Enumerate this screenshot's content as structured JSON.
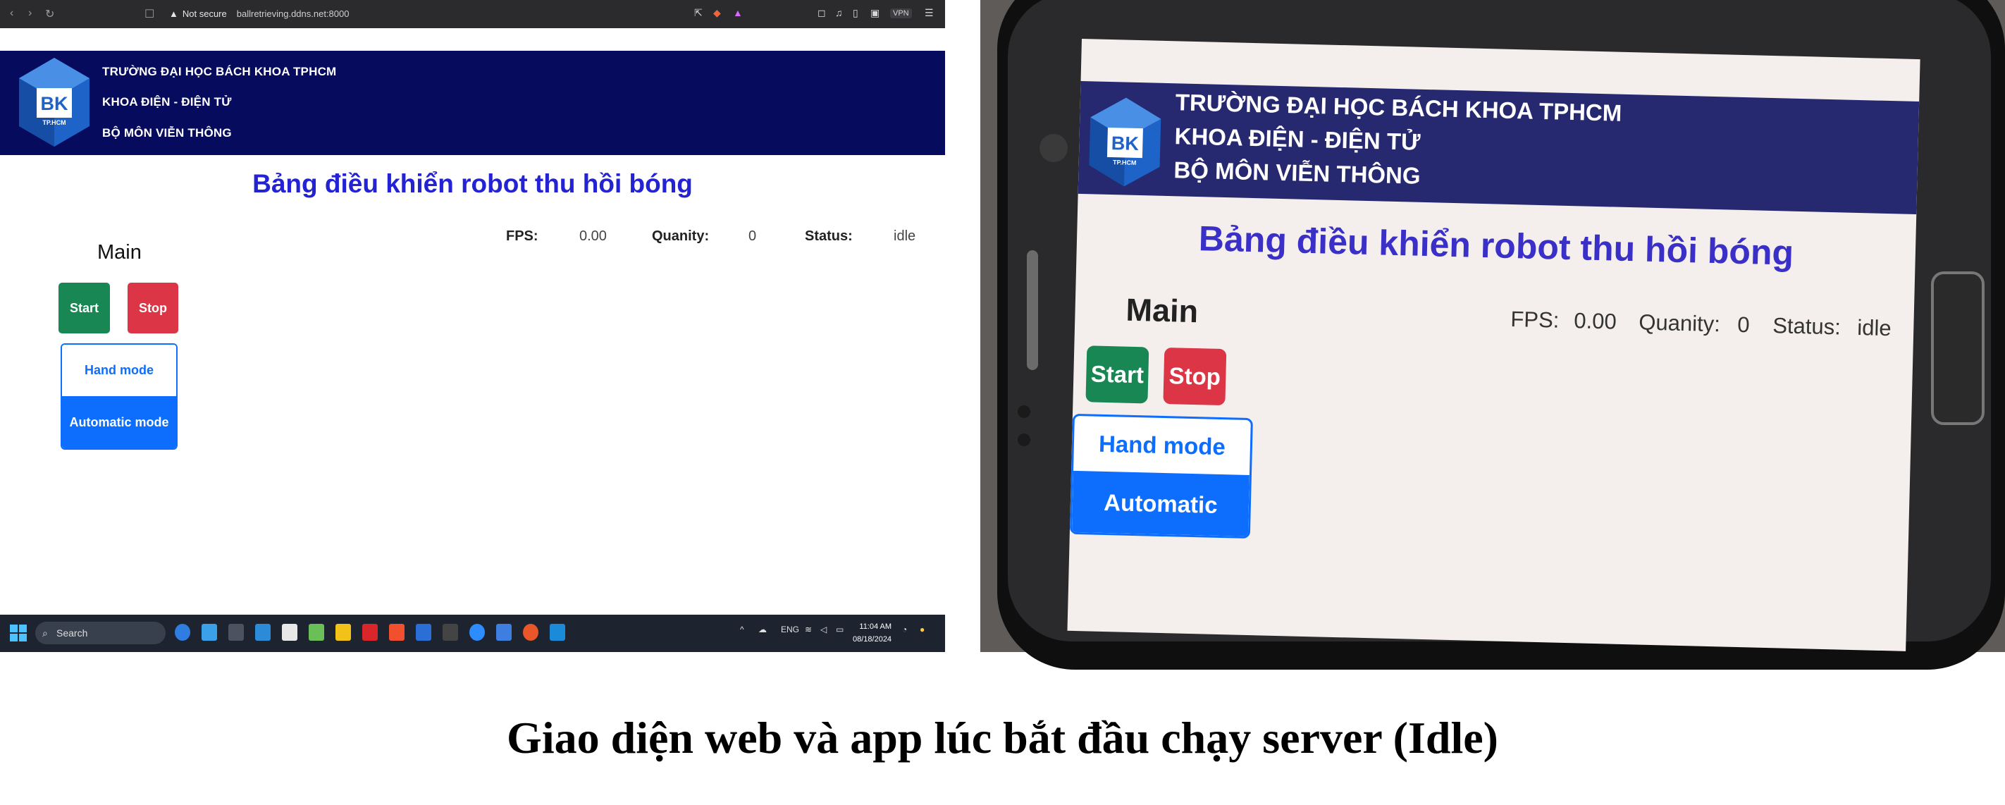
{
  "browser": {
    "security_label": "Not secure",
    "url": "ballretrieving.ddns.net:8000",
    "vpn_label": "VPN"
  },
  "site": {
    "logo_text": "BK",
    "logo_subtext": "TP.HCM",
    "header_lines": [
      "TRƯỜNG ĐẠI HỌC BÁCH KHOA TPHCM",
      "KHOA ĐIỆN - ĐIỆN TỬ",
      "BỘ MÔN VIỄN THÔNG"
    ],
    "title": "Bảng điều khiển robot thu hồi bóng",
    "main_label": "Main",
    "fps_label": "FPS:",
    "fps_value": "0.00",
    "quantity_label": "Quanity:",
    "quantity_value": "0",
    "status_label": "Status:",
    "status_value": "idle",
    "start_label": "Start",
    "stop_label": "Stop",
    "hand_mode_label": "Hand mode",
    "auto_mode_label": "Automatic mode"
  },
  "taskbar": {
    "search_label": "Search",
    "lang": "ENG",
    "time": "11:04 AM",
    "date": "08/18/2024"
  },
  "caption": "Giao diện web và app lúc bắt đầu chạy server (Idle)",
  "colors": {
    "header_bg": "#060b5e",
    "title": "#2323d4",
    "start": "#198754",
    "stop": "#dc3545",
    "mode_accent": "#0d6efd"
  }
}
